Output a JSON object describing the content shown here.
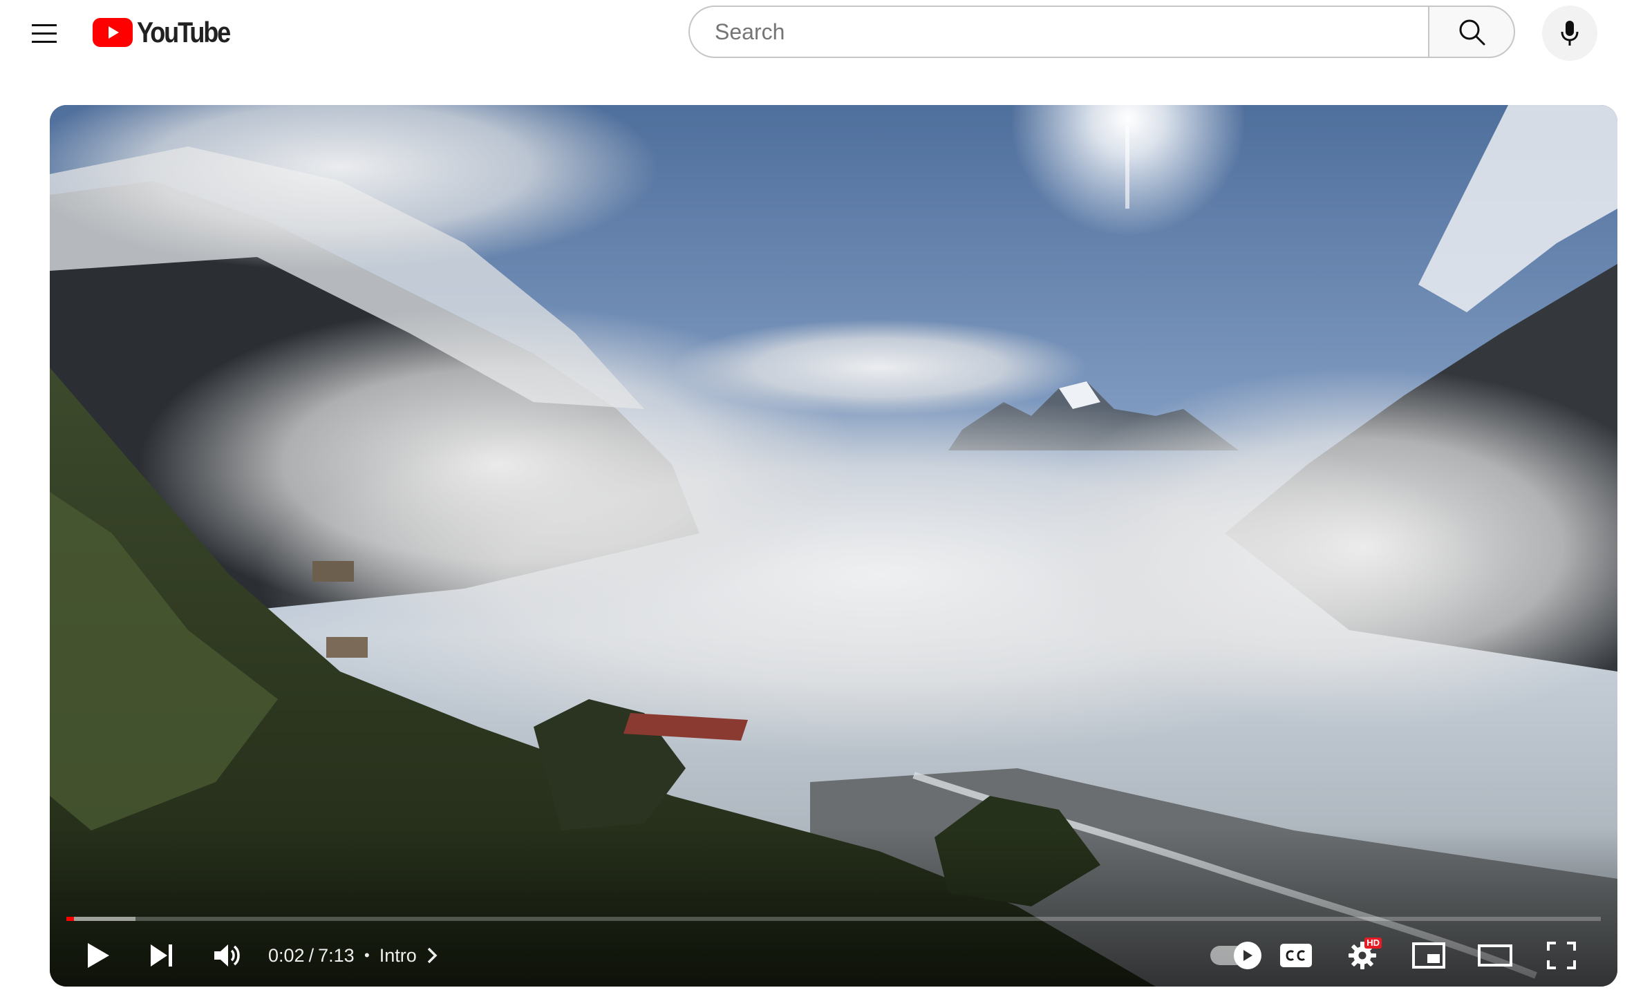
{
  "header": {
    "logo_text": "YouTube",
    "search_placeholder": "Search",
    "search_value": ""
  },
  "player": {
    "current_time": "0:02",
    "time_separator": "/",
    "duration": "7:13",
    "chapter_separator": "•",
    "chapter_title": "Intro",
    "progress_fraction": 0.005,
    "buffered_fraction": 0.045,
    "progress_color": "#ff0000",
    "settings_badge": "HD",
    "autoplay_on": true
  },
  "colors": {
    "brand_red": "#ff0000",
    "text_primary": "#0f0f0f",
    "border": "#c6c6c6"
  },
  "icons": [
    "menu-icon",
    "youtube-logo-icon",
    "search-icon",
    "mic-icon",
    "play-icon",
    "next-icon",
    "volume-icon",
    "chevron-right-icon",
    "autoplay-toggle-icon",
    "captions-icon",
    "settings-icon",
    "miniplayer-icon",
    "theater-mode-icon",
    "fullscreen-icon"
  ]
}
